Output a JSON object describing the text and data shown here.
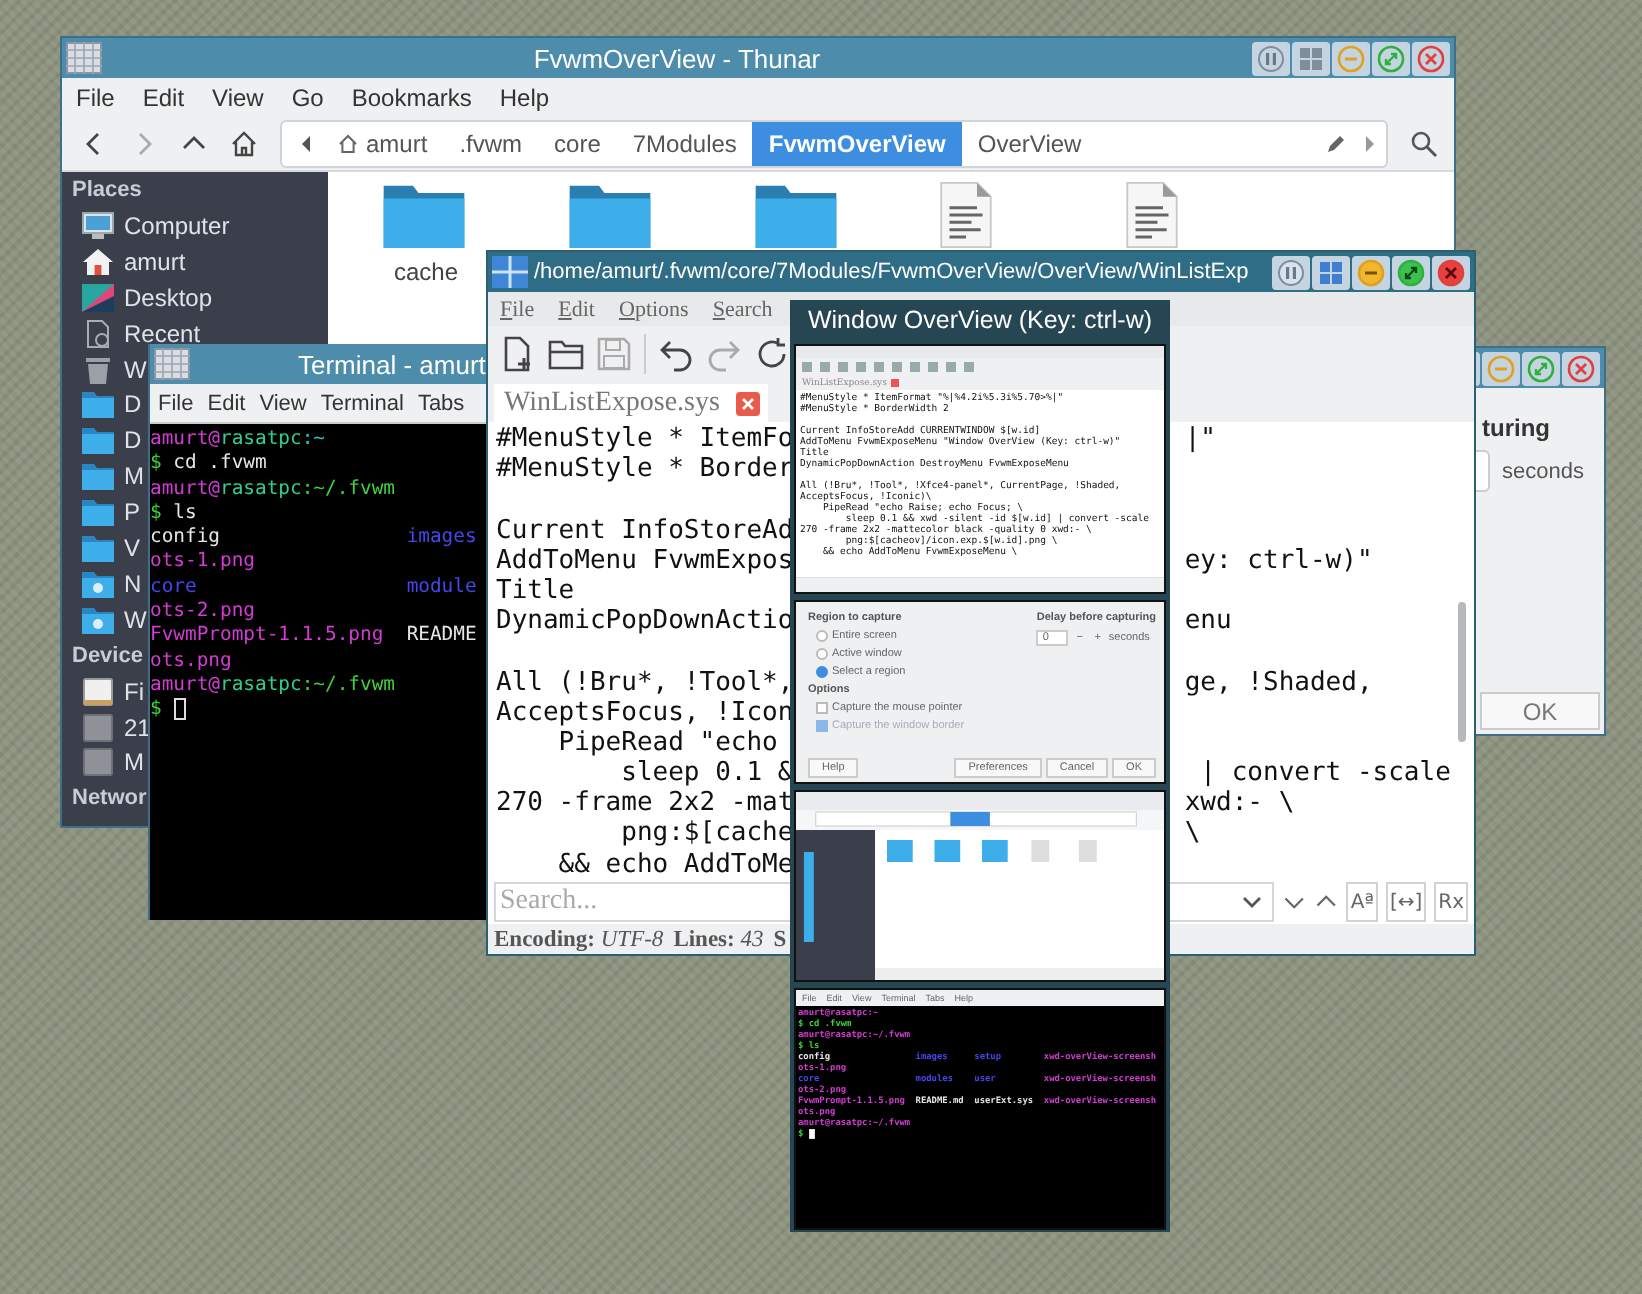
{
  "thunar": {
    "title": "FvwmOverView - Thunar",
    "menu": [
      "File",
      "Edit",
      "View",
      "Go",
      "Bookmarks",
      "Help"
    ],
    "path": [
      {
        "label": "amurt",
        "kind": "home",
        "selected": false
      },
      {
        "label": ".fvwm",
        "kind": "folder",
        "selected": false
      },
      {
        "label": "core",
        "kind": "folder",
        "selected": false
      },
      {
        "label": "7Modules",
        "kind": "folder",
        "selected": false
      },
      {
        "label": "FvwmOverView",
        "kind": "folder",
        "selected": true
      },
      {
        "label": "OverView",
        "kind": "folder",
        "selected": false
      }
    ],
    "sidebar": [
      {
        "heading": "Places",
        "items": [
          {
            "label": "Computer",
            "kind": "computer"
          },
          {
            "label": "amurt",
            "kind": "home"
          },
          {
            "label": "Desktop",
            "kind": "desktop"
          },
          {
            "label": "Recent",
            "kind": "recent"
          },
          {
            "label": "W",
            "kind": "trash"
          },
          {
            "label": "D",
            "kind": "folder"
          },
          {
            "label": "D",
            "kind": "folder"
          },
          {
            "label": "M",
            "kind": "folder"
          },
          {
            "label": "P",
            "kind": "folder"
          },
          {
            "label": "V",
            "kind": "folder"
          },
          {
            "label": "N",
            "kind": "network"
          },
          {
            "label": "W",
            "kind": "network"
          }
        ]
      },
      {
        "heading": "Device",
        "items": [
          {
            "label": "Fi",
            "kind": "drive"
          },
          {
            "label": "21",
            "kind": "disk"
          },
          {
            "label": "M",
            "kind": "disk"
          }
        ]
      },
      {
        "heading": "Networ"
      }
    ],
    "files": [
      {
        "kind": "folder",
        "label": "cache"
      },
      {
        "kind": "folder"
      },
      {
        "kind": "folder"
      },
      {
        "kind": "file"
      },
      {
        "kind": "file"
      }
    ]
  },
  "capture_dialog": {
    "heading": "turing",
    "unit": "seconds",
    "button": "OK"
  },
  "terminal": {
    "title": "Terminal - amurt",
    "menu": [
      "File",
      "Edit",
      "View",
      "Terminal",
      "Tabs"
    ],
    "lines": [
      {
        "cursor": false,
        "segments": [
          {
            "text": "amurt@",
            "color": "#d23cd2"
          },
          {
            "text": "rasatpc",
            "color": "#2fd08a"
          },
          {
            "text": ":~",
            "color": "#2cc4c4"
          }
        ]
      },
      {
        "cursor": false,
        "segments": [
          {
            "text": "$",
            "color": "#3cd23c"
          },
          {
            "text": " cd .fvwm",
            "color": "#e6e6e6"
          }
        ]
      },
      {
        "cursor": false,
        "segments": [
          {
            "text": "amurt@",
            "color": "#d23cd2"
          },
          {
            "text": "rasatpc",
            "color": "#2fd08a"
          },
          {
            "text": ":~/.fvwm",
            "color": "#3cd23c"
          }
        ]
      },
      {
        "cursor": false,
        "segments": [
          {
            "text": "$",
            "color": "#3cd23c"
          },
          {
            "text": " ls",
            "color": "#e6e6e6"
          }
        ]
      },
      {
        "cursor": false,
        "segments": [
          {
            "text": "config                ",
            "color": "#e6e6e6"
          },
          {
            "text": "images",
            "color": "#4646ee"
          }
        ]
      },
      {
        "cursor": false,
        "segments": [
          {
            "text": "ots-1.png",
            "color": "#d23cd2"
          }
        ]
      },
      {
        "cursor": false,
        "segments": [
          {
            "text": "core                  ",
            "color": "#4646ee"
          },
          {
            "text": "module",
            "color": "#4646ee"
          }
        ]
      },
      {
        "cursor": false,
        "segments": [
          {
            "text": "ots-2.png",
            "color": "#d23cd2"
          }
        ]
      },
      {
        "cursor": false,
        "segments": [
          {
            "text": "FvwmPrompt-1.1.5.png  ",
            "color": "#d23cd2"
          },
          {
            "text": "README",
            "color": "#e6e6e6"
          }
        ]
      },
      {
        "cursor": false,
        "segments": [
          {
            "text": "ots.png",
            "color": "#d23cd2"
          }
        ]
      },
      {
        "cursor": false,
        "segments": [
          {
            "text": "amurt@",
            "color": "#d23cd2"
          },
          {
            "text": "rasatpc",
            "color": "#2fd08a"
          },
          {
            "text": ":~/.fvwm",
            "color": "#3cd23c"
          }
        ]
      },
      {
        "cursor": true,
        "segments": [
          {
            "text": "$ ",
            "color": "#3cd23c"
          }
        ]
      }
    ]
  },
  "editor": {
    "title": "/home/amurt/.fvwm/core/7Modules/FvwmOverView/OverView/WinListExp",
    "menu": [
      "File",
      "Edit",
      "Options",
      "Search"
    ],
    "tab": "WinListExpose.sys",
    "code": [
      [
        {
          "left": "#MenuStyle * ItemFo",
          "right": "|\""
        },
        {
          "left": "#MenuStyle * Border"
        }
      ],
      [
        {
          "left": "Current InfoStoreAd"
        },
        {
          "left": "AddToMenu FvwmExpos",
          "right": "ey: ctrl-w)\""
        },
        {
          "left": "Title"
        },
        {
          "left": "DynamicPopDownActio",
          "right": "enu"
        }
      ],
      [
        {
          "left": "All (!Bru*, !Tool*,",
          "right": "ge, !Shaded,"
        },
        {
          "left": "AcceptsFocus, !Icon"
        },
        {
          "left": "    PipeRead \"echo"
        },
        {
          "left": "        sleep 0.1 &",
          "right": " | convert -scale"
        },
        {
          "left": "270 -frame 2x2 -mat",
          "right": "xwd:- \\"
        },
        {
          "left": "        png:$[cache",
          "right": "\\"
        },
        {
          "left": "    && echo AddToMe"
        }
      ]
    ],
    "search": {
      "placeholder": "Search..."
    },
    "search_options": [
      "Aª",
      "[↔]",
      "Rx"
    ],
    "status": [
      {
        "label": "Encoding:",
        "value": "UTF-8"
      },
      {
        "label": "Lines:",
        "value": "43"
      }
    ],
    "status_cut": "S"
  },
  "overview": {
    "title": "Window OverView (Key: ctrl-w)",
    "thumbnails": [
      {
        "kind": "editor",
        "tab": "WinListExpose.sys",
        "code": [
          [
            "#MenuStyle * ItemFormat \"%|%4.2i%5.3i%5.70>%|\"",
            "#MenuStyle * BorderWidth 2"
          ],
          [
            "Current InfoStoreAdd CURRENTWINDOW $[w.id]",
            "AddToMenu FvwmExposeMenu \"Window OverView (Key: ctrl-w)\"",
            "Title",
            "DynamicPopDownAction DestroyMenu FvwmExposeMenu"
          ],
          [
            "All (!Bru*, !Tool*, !Xfce4-panel*, CurrentPage, !Shaded,",
            "AcceptsFocus, !Iconic)\\",
            "    PipeRead \"echo Raise; echo Focus; \\",
            "        sleep 0.1 && xwd -silent -id $[w.id] | convert -scale",
            "270 -frame 2x2 -mattecolor black -quality 0 xwd:- \\",
            "        png:$[cacheov]/icon.exp.$[w.id].png \\",
            "    && echo AddToMenu FvwmExposeMenu \\"
          ]
        ]
      },
      {
        "kind": "capture-dialog",
        "region_heading": "Region to capture",
        "regions": [
          {
            "label": "Entire screen",
            "selected": false
          },
          {
            "label": "Active window",
            "selected": false
          },
          {
            "label": "Select a region",
            "selected": true
          }
        ],
        "options_heading": "Options",
        "options": [
          {
            "label": "Capture the mouse pointer",
            "checked": false,
            "disabled": false
          },
          {
            "label": "Capture the window border",
            "checked": true,
            "disabled": true
          }
        ],
        "delay_heading": "Delay before capturing",
        "delay": "0",
        "minus": "−",
        "plus": "+",
        "unit": "seconds",
        "buttons": [
          "Help",
          "Preferences",
          "Cancel",
          "OK"
        ]
      },
      {
        "kind": "file-manager"
      },
      {
        "kind": "terminal",
        "menu": [
          "File",
          "Edit",
          "View",
          "Terminal",
          "Tabs",
          "Help"
        ],
        "lines": [
          {
            "cursor": false,
            "segments": [
              {
                "text": "amurt@rasatpc:~",
                "color": "#d23cd2"
              }
            ]
          },
          {
            "cursor": false,
            "segments": [
              {
                "text": "$ cd .fvwm",
                "color": "#3cd23c"
              }
            ]
          },
          {
            "cursor": false,
            "segments": [
              {
                "text": "amurt@rasatpc:~/.fvwm",
                "color": "#d23cd2"
              }
            ]
          },
          {
            "cursor": false,
            "segments": [
              {
                "text": "$ ls",
                "color": "#3cd23c"
              }
            ]
          },
          {
            "cursor": false,
            "segments": [
              {
                "text": "config                ",
                "color": "#e6e6e6"
              },
              {
                "text": "images     ",
                "color": "#4646ee"
              },
              {
                "text": "setup        ",
                "color": "#4646ee"
              },
              {
                "text": "xwd-overView-screensh",
                "color": "#d23cd2"
              }
            ]
          },
          {
            "cursor": false,
            "segments": [
              {
                "text": "ots-1.png",
                "color": "#d23cd2"
              }
            ]
          },
          {
            "cursor": false,
            "segments": [
              {
                "text": "core                  ",
                "color": "#4646ee"
              },
              {
                "text": "modules    ",
                "color": "#4646ee"
              },
              {
                "text": "user         ",
                "color": "#4646ee"
              },
              {
                "text": "xwd-overView-screensh",
                "color": "#d23cd2"
              }
            ]
          },
          {
            "cursor": false,
            "segments": [
              {
                "text": "ots-2.png",
                "color": "#d23cd2"
              }
            ]
          },
          {
            "cursor": false,
            "segments": [
              {
                "text": "FvwmPrompt-1.1.5.png  ",
                "color": "#d23cd2"
              },
              {
                "text": "README.md  ",
                "color": "#e6e6e6"
              },
              {
                "text": "userExt.sys  ",
                "color": "#e6e6e6"
              },
              {
                "text": "xwd-overView-screensh",
                "color": "#d23cd2"
              }
            ]
          },
          {
            "cursor": false,
            "segments": [
              {
                "text": "ots.png",
                "color": "#d23cd2"
              }
            ]
          },
          {
            "cursor": false,
            "segments": [
              {
                "text": "amurt@rasatpc:~/.fvwm",
                "color": "#d23cd2"
              }
            ]
          },
          {
            "cursor": true,
            "segments": [
              {
                "text": "$ ",
                "color": "#3cd23c"
              }
            ]
          }
        ]
      }
    ]
  }
}
